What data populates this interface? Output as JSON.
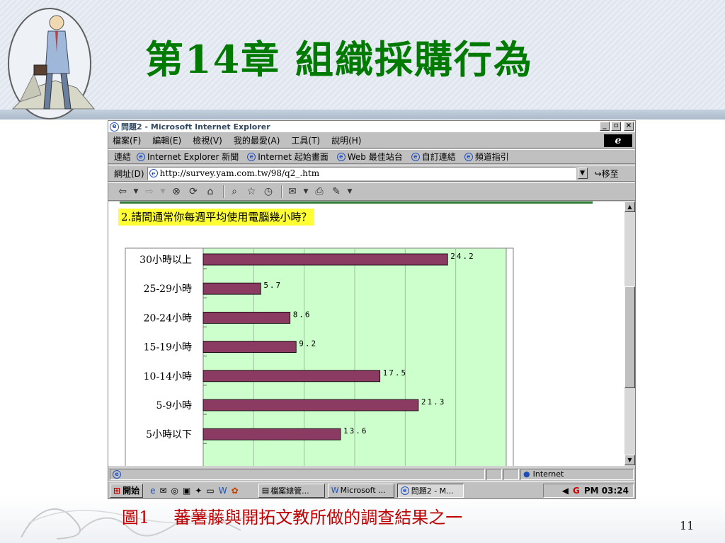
{
  "slide": {
    "title": "第14章  組織採購行為",
    "caption_prefix": "圖1",
    "caption_text": "蕃薯藤與開拓文教所做的調查結果之一",
    "page_number": "11"
  },
  "window": {
    "title": "問題2 - Microsoft Internet Explorer",
    "controls": [
      "_",
      "▫",
      "×"
    ],
    "menu": [
      "檔案(F)",
      "編輯(E)",
      "檢視(V)",
      "我的最愛(A)",
      "工具(T)",
      "說明(H)"
    ],
    "links_label": "連結",
    "links": [
      "Internet Explorer 新聞",
      "Internet 起始畫面",
      "Web 最佳站台",
      "自訂連結",
      "頻道指引"
    ],
    "address_label": "網址(D)",
    "address_value": "http://survey.yam.com.tw/98/q2_.htm",
    "go_label": "移至",
    "toolbar_icons": [
      "back-icon",
      "forward-icon",
      "stop-icon",
      "refresh-icon",
      "home-icon",
      "search-icon",
      "favorites-icon",
      "history-icon",
      "mail-icon",
      "print-icon",
      "edit-icon"
    ]
  },
  "content": {
    "question": "2.請問通常你每週平均使用電腦幾小時？"
  },
  "chart_data": {
    "type": "bar",
    "orientation": "horizontal",
    "categories": [
      "30小時以上",
      "25-29小時",
      "20-24小時",
      "15-19小時",
      "10-14小時",
      "5-9小時",
      "5小時以下"
    ],
    "values": [
      24.2,
      5.7,
      8.6,
      9.2,
      17.5,
      21.3,
      13.6
    ],
    "value_labels": [
      "24.2",
      "5.7",
      "8.6",
      "9.2",
      "17.5",
      "21.3",
      "13.6"
    ],
    "xlim": [
      0,
      30
    ],
    "grid": true,
    "bar_color": "#8b3a62",
    "plot_bg": "#ccffcc"
  },
  "status": {
    "zone": "Internet"
  },
  "taskbar": {
    "start_label": "開始",
    "tasks": [
      "檔案總管...",
      "Microsoft ...",
      "問題2 - M..."
    ],
    "clock": "PM 03:24"
  }
}
